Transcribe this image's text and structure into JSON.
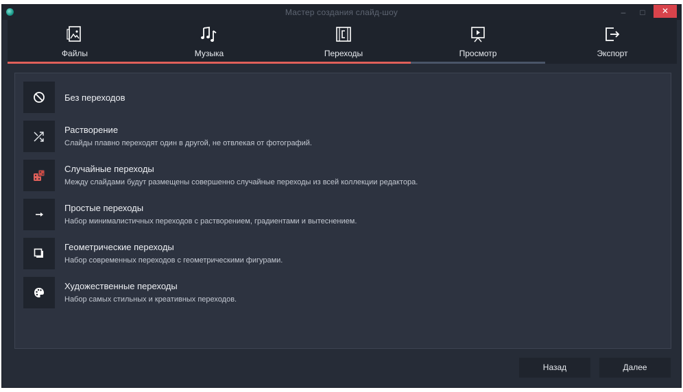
{
  "window": {
    "title": "Мастер создания слайд-шоу"
  },
  "tabs": [
    {
      "label": "Файлы",
      "icon": "photo-file-icon",
      "state": "done"
    },
    {
      "label": "Музыка",
      "icon": "music-notes-icon",
      "state": "done"
    },
    {
      "label": "Переходы",
      "icon": "film-transition-icon",
      "state": "active"
    },
    {
      "label": "Просмотр",
      "icon": "presentation-play-icon",
      "state": "todo"
    },
    {
      "label": "Экспорт",
      "icon": "export-arrow-icon",
      "state": "todo"
    }
  ],
  "transitions": [
    {
      "title": "Без переходов",
      "desc": "",
      "icon": "no-entry-icon"
    },
    {
      "title": "Растворение",
      "desc": "Слайды плавно переходят один в другой, не отвлекая от фотографий.",
      "icon": "shuffle-icon"
    },
    {
      "title": "Случайные переходы",
      "desc": "Между слайдами будут размещены совершенно случайные переходы из всей коллекции редактора.",
      "icon": "dice-icon"
    },
    {
      "title": "Простые переходы",
      "desc": "Набор минималистичных переходов с растворением, градиентами и вытеснением.",
      "icon": "arrow-right-icon"
    },
    {
      "title": "Геометрические переходы",
      "desc": "Набор современных переходов с геометрическими фигурами.",
      "icon": "stacked-squares-icon"
    },
    {
      "title": "Художественные переходы",
      "desc": "Набор самых стильных и креативных переходов.",
      "icon": "palette-icon"
    }
  ],
  "buttons": {
    "back": "Назад",
    "next": "Далее"
  },
  "colors": {
    "accent": "#e0605a",
    "background": "#262c37",
    "panel": "#2d3340"
  }
}
